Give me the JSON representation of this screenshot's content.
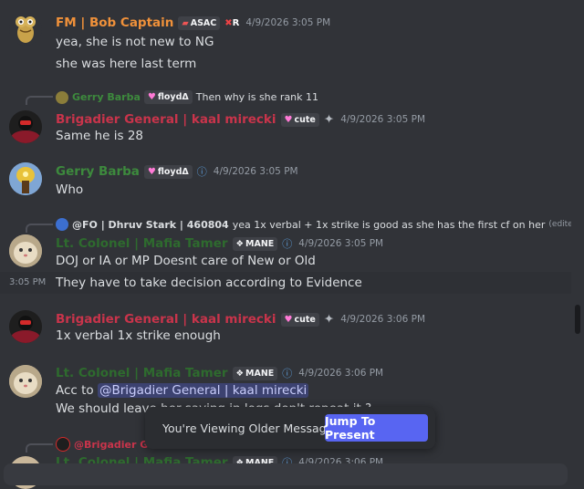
{
  "messages": [
    {
      "author": "FM | Bob Captain",
      "author_color": "#f0913a",
      "badge": "ASAC",
      "badge2": "R",
      "timestamp": "4/9/2026 3:05 PM",
      "lines": [
        "yea, she is not new to NG",
        "she was here last term"
      ]
    },
    {
      "reply": {
        "author": "Gerry Barba",
        "tag": "floydΔ",
        "text": "Then why is she rank 11"
      },
      "author": "Brigadier General | kaal mirecki",
      "author_color": "#c9344b",
      "badge": "cute",
      "timestamp": "4/9/2026 3:05 PM",
      "lines": [
        "Same he is 28"
      ]
    },
    {
      "author": "Gerry Barba",
      "author_color": "#3d8a3d",
      "badge": "floydΔ",
      "timestamp": "4/9/2026 3:05 PM",
      "lines": [
        "Who"
      ]
    },
    {
      "reply": {
        "author": "@FO | Dhruv Stark | 460804",
        "text": "yea 1x verbal + 1x strike  is good as she has the first cf on her",
        "edited": "(edited)"
      },
      "author": "Lt. Colonel | Mafia Tamer",
      "author_color": "#2e6b2e",
      "badge": "MANE",
      "timestamp": "4/9/2026 3:05 PM",
      "lines": [
        "DOJ or IA or MP Doesnt care of New or Old"
      ],
      "hover_timestamp": "3:05 PM",
      "extra_line": "They have to take decision according to Evidence"
    },
    {
      "author": "Brigadier General | kaal mirecki",
      "author_color": "#c9344b",
      "badge": "cute",
      "timestamp": "4/9/2026 3:06 PM",
      "lines": [
        "1x verbal 1x strike enough"
      ]
    },
    {
      "author": "Lt. Colonel | Mafia Tamer",
      "author_color": "#2e6b2e",
      "badge": "MANE",
      "timestamp": "4/9/2026 3:06 PM",
      "line1_prefix": "Acc to ",
      "mention": "@Brigadier General | kaal mirecki",
      "line2": "We should leave her saying in logs don't repeat it ?"
    },
    {
      "reply": {
        "author": "@Brigadier Ge"
      },
      "author": "Lt. Colonel | Mafia Tamer",
      "author_color": "#2e6b2e",
      "badge": "MANE",
      "timestamp": "4/9/2026 3:06 PM"
    }
  ],
  "banner": {
    "text": "You're Viewing Older Messages",
    "button": "Jump To Present",
    "button_color": "#5865f2"
  }
}
